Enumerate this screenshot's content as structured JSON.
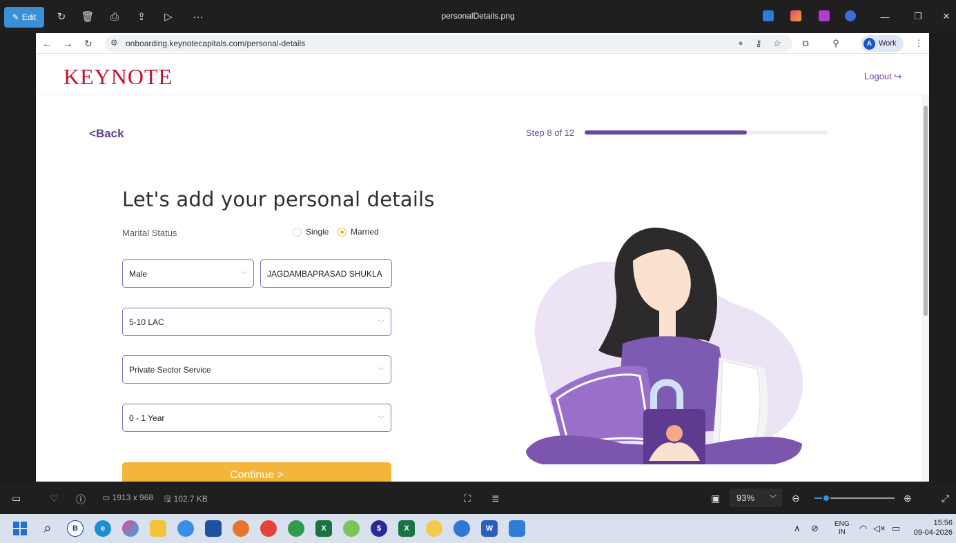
{
  "viewer": {
    "edit_label": "Edit",
    "title": "personalDetails.png",
    "image_size": "1913 x 968",
    "file_size": "102.7 KB",
    "zoom": "93%",
    "zoom_fraction": 0.15
  },
  "browser": {
    "url": "onboarding.keynotecapitals.com/personal-details",
    "profile_initial": "A",
    "profile_label": "Work"
  },
  "header": {
    "logo": "KEYNOTE",
    "logout": "Logout"
  },
  "nav": {
    "back": "Back",
    "step_text": "Step 8 of 12",
    "step_current": 8,
    "step_total": 12
  },
  "form": {
    "title": "Let's add your personal details",
    "marital_label": "Marital Status",
    "marital_options": [
      "Single",
      "Married"
    ],
    "marital_selected": "Married",
    "gender": "Male",
    "father_name": "JAGDAMBAPRASAD SHUKLA",
    "income": "5-10 LAC",
    "occupation": "Private Sector Service",
    "experience": "0 - 1 Year",
    "continue": "Continue"
  },
  "taskbar": {
    "lang_top": "ENG",
    "lang_bottom": "IN",
    "time": "15:56",
    "date": "09-04-2026"
  },
  "colors": {
    "brand_red": "#c8102e",
    "brand_purple": "#6c47a2",
    "accent_yellow": "#f3b63a"
  }
}
